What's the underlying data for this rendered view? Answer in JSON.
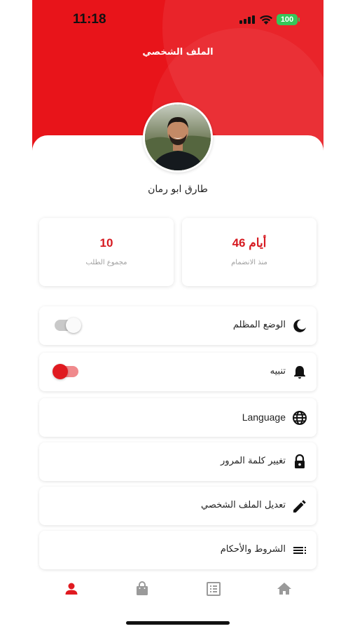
{
  "status_bar": {
    "time": "11:18",
    "battery": "100"
  },
  "header": {
    "title": "الملف الشخصي"
  },
  "profile": {
    "name": "طارق ابو رمان"
  },
  "stats": [
    {
      "value": "46 أيام",
      "label": "منذ الانضمام"
    },
    {
      "value": "10",
      "label": "مجموع الطلب"
    }
  ],
  "settings": [
    {
      "label": "الوضع المظلم",
      "icon": "moon-icon",
      "control": "toggle",
      "on": false
    },
    {
      "label": "تنبيه",
      "icon": "bell-icon",
      "control": "toggle",
      "on": true
    },
    {
      "label": "Language",
      "icon": "globe-icon"
    },
    {
      "label": "تغيير كلمة المرور",
      "icon": "lock-icon"
    },
    {
      "label": "تعديل الملف الشخصي",
      "icon": "pencil-icon"
    },
    {
      "label": "الشروط والأحكام",
      "icon": "list-icon"
    }
  ],
  "bottom_nav": [
    {
      "icon": "person-icon",
      "active": true
    },
    {
      "icon": "shopping-bag-icon",
      "active": false
    },
    {
      "icon": "list-alt-icon",
      "active": false
    },
    {
      "icon": "home-icon",
      "active": false
    }
  ],
  "colors": {
    "primary": "#e8141a",
    "accent_text": "#d61a21",
    "toggle_on": "#e01a20",
    "nav_inactive": "#9a9a9a"
  }
}
